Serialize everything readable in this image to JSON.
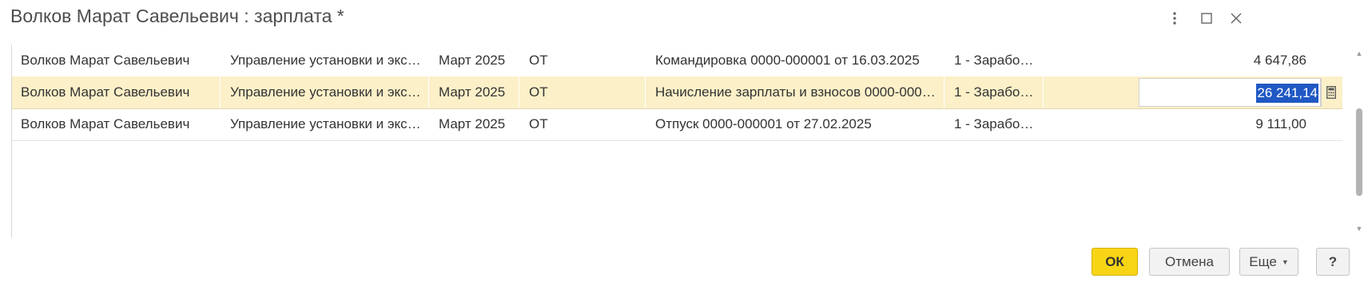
{
  "window": {
    "title": "Волков Марат Савельевич : зарплата *",
    "controls": {
      "more_icon": "vertical-dots-icon",
      "maximize_icon": "maximize-icon",
      "close_icon": "close-icon"
    }
  },
  "table": {
    "rows": [
      {
        "employee": "Волков Марат Савельевич",
        "department": "Управление установки и экс…",
        "period": "Март 2025",
        "code": "ОТ",
        "document": "Командировка 0000-000001 от 16.03.2025",
        "account": "1 - Зарабо…",
        "amount": "4 647,86",
        "selected": false
      },
      {
        "employee": "Волков Марат Савельевич",
        "department": "Управление установки и экс…",
        "period": "Март 2025",
        "code": "ОТ",
        "document": "Начисление зарплаты и взносов 0000-000…",
        "account": "1 - Зарабо…",
        "amount": "26 241,14",
        "selected": true,
        "editing": true
      },
      {
        "employee": "Волков Марат Савельевич",
        "department": "Управление установки и экс…",
        "period": "Март 2025",
        "code": "ОТ",
        "document": "Отпуск 0000-000001 от 27.02.2025",
        "account": "1 - Зарабо…",
        "amount": "9 111,00",
        "selected": false
      }
    ],
    "editor_icon": "calculator-icon"
  },
  "footer": {
    "ok_label": "ОК",
    "cancel_label": "Отмена",
    "more_label": "Еще",
    "help_label": "?"
  },
  "colors": {
    "selected_row": "#fbf0c8",
    "ok_button": "#f8d514",
    "text_selection": "#2058c4"
  }
}
